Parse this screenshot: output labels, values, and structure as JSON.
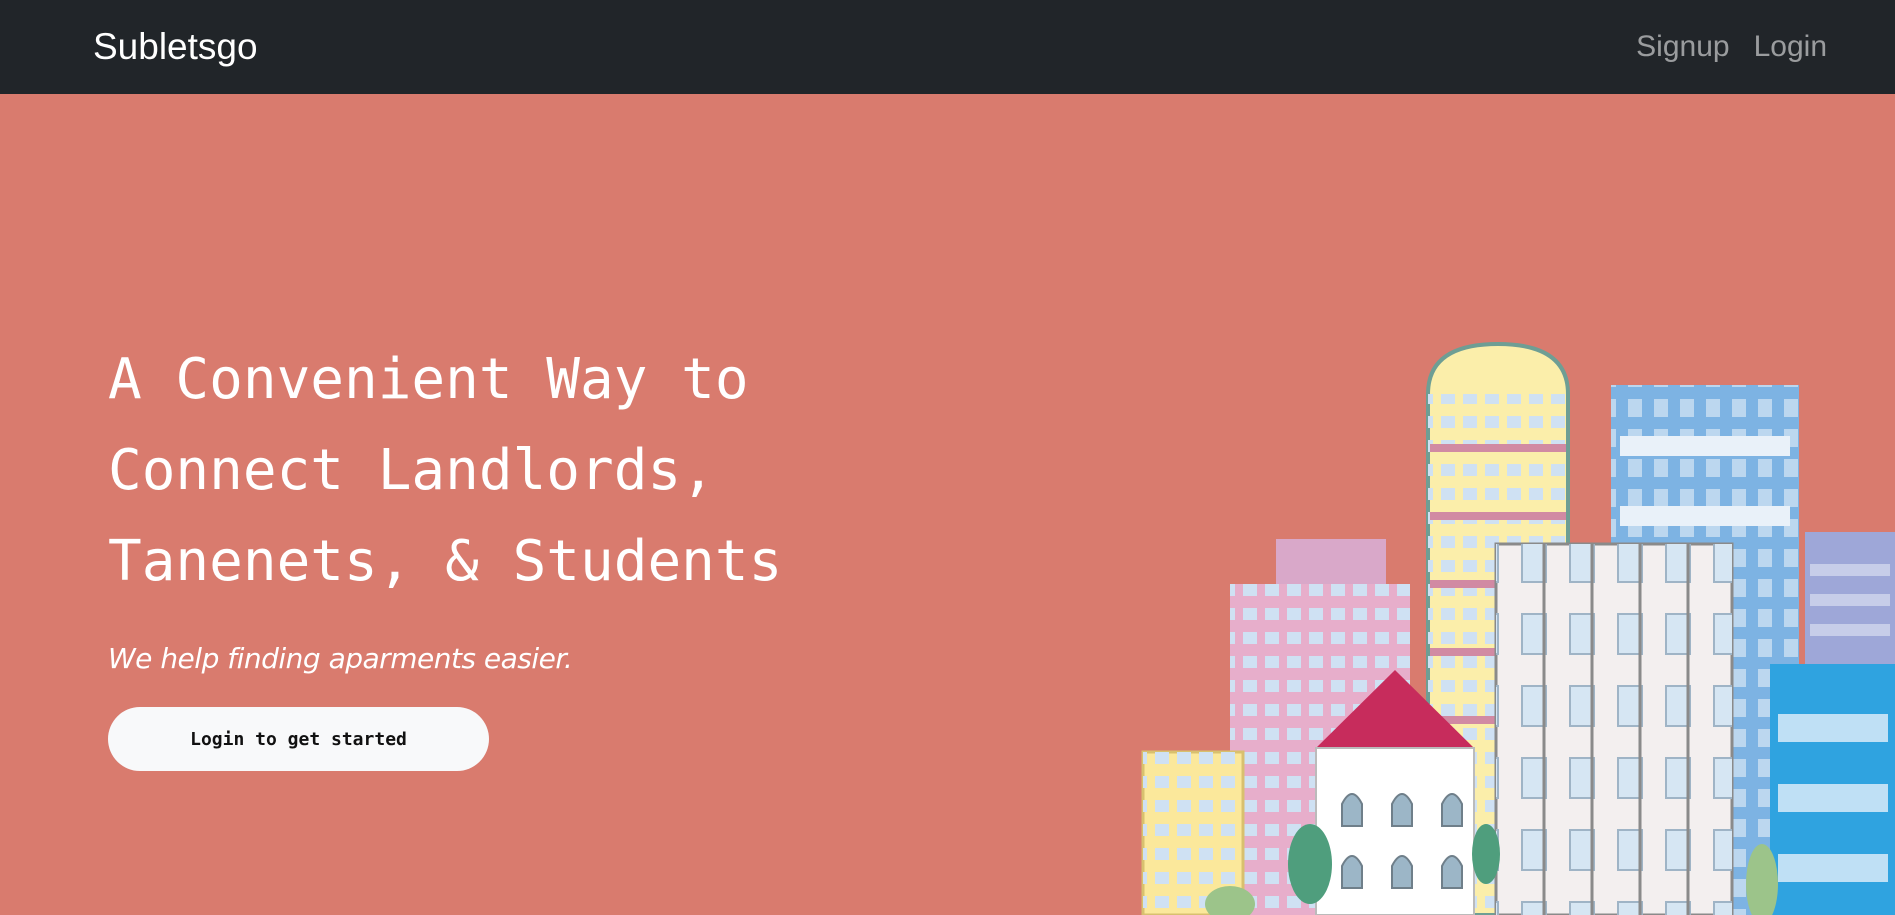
{
  "navbar": {
    "brand": "Subletsgo",
    "links": [
      "Signup",
      "Login"
    ]
  },
  "hero": {
    "title_lines": [
      "A Convenient Way to",
      "Connect Landlords,",
      "Tanenets, & Students"
    ],
    "subtitle": "We help finding aparments easier.",
    "cta_label": "Login to get started"
  },
  "colors": {
    "navbar_bg": "#212529",
    "hero_bg": "#d97b6e",
    "button_bg": "#f8f9fa"
  },
  "illustration": {
    "name": "city-buildings-illustration"
  }
}
